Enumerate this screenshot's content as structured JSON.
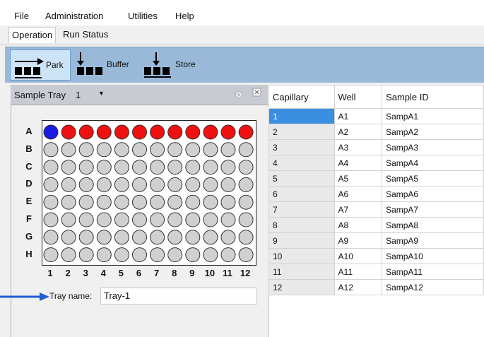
{
  "menu": {
    "items": [
      "File",
      "Administration",
      "Utilities",
      "Help"
    ]
  },
  "tabs": [
    {
      "label": "Operation",
      "active": true
    },
    {
      "label": "Run Status",
      "active": false
    }
  ],
  "toolbar": {
    "park_label": "Park",
    "buffer_label": "Buffer",
    "store_label": "Store"
  },
  "tray": {
    "header_label": "Sample Tray",
    "selected_tray": "1",
    "row_labels": [
      "A",
      "B",
      "C",
      "D",
      "E",
      "F",
      "G",
      "H"
    ],
    "col_labels": [
      "1",
      "2",
      "3",
      "4",
      "5",
      "6",
      "7",
      "8",
      "9",
      "10",
      "11",
      "12"
    ],
    "well_colors": {
      "selected": "#1a1ae0",
      "filled": "#ee1111",
      "empty": "#d0d0d0"
    },
    "tray_name_label": "Tray name:",
    "tray_name_value": "Tray-1"
  },
  "grid": {
    "columns": [
      "Capillary",
      "Well",
      "Sample ID"
    ],
    "rows": [
      [
        "1",
        "A1",
        "SampA1"
      ],
      [
        "2",
        "A2",
        "SampA2"
      ],
      [
        "3",
        "A3",
        "SampA3"
      ],
      [
        "4",
        "A4",
        "SampA4"
      ],
      [
        "5",
        "A5",
        "SampA5"
      ],
      [
        "6",
        "A6",
        "SampA6"
      ],
      [
        "7",
        "A7",
        "SampA7"
      ],
      [
        "8",
        "A8",
        "SampA8"
      ],
      [
        "9",
        "A9",
        "SampA9"
      ],
      [
        "10",
        "A10",
        "SampA10"
      ],
      [
        "11",
        "A11",
        "SampA11"
      ],
      [
        "12",
        "A12",
        "SampA12"
      ]
    ],
    "selected_row": 0
  },
  "annotation": {
    "arrow_color": "#1f5fd0"
  }
}
